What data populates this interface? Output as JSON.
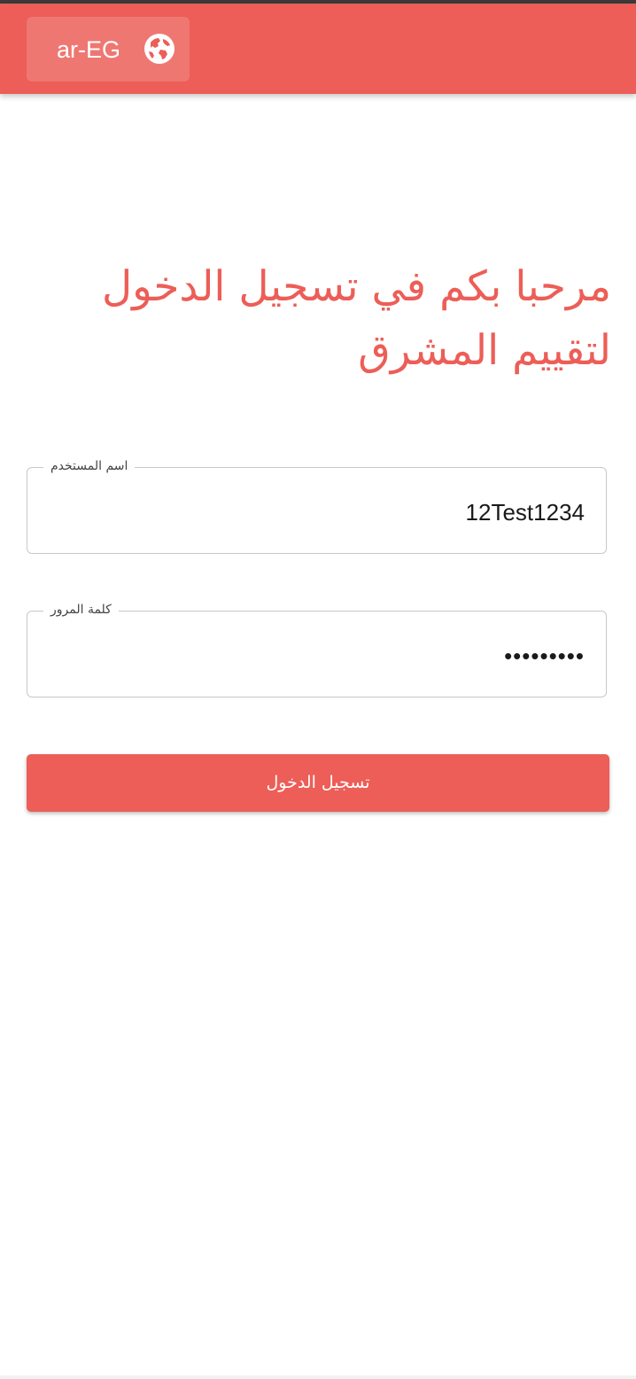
{
  "appbar": {
    "language_label": "ar-EG",
    "language_icon": "globe-icon",
    "background_color": "#ec5e57"
  },
  "page": {
    "title": "مرحبا بكم في تسجيل الدخول لتقييم المشرق"
  },
  "form": {
    "username": {
      "label": "اسم المستخدم",
      "value": "12Test1234"
    },
    "password": {
      "label": "كلمة المرور",
      "value": "•••••••••"
    },
    "submit_label": "تسجيل الدخول"
  },
  "colors": {
    "accent": "#ec5e57",
    "field_border": "#c8c8c8"
  }
}
